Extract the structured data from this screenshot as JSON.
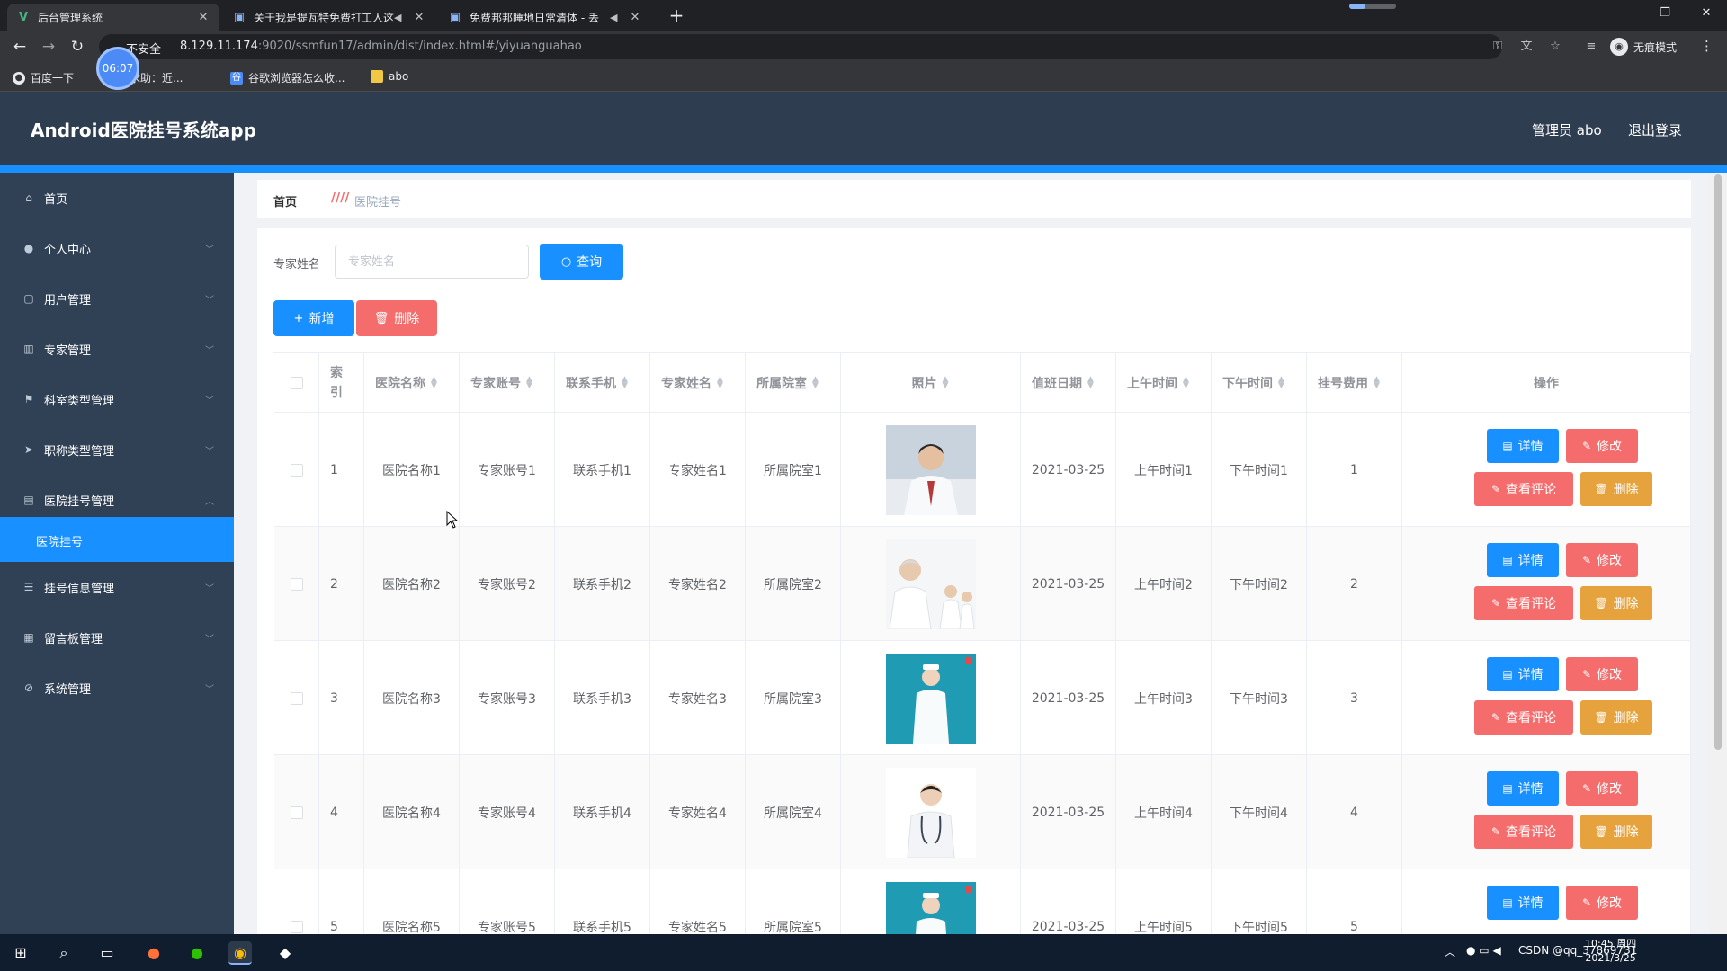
{
  "browser": {
    "tabs": [
      {
        "title": "后台管理系统",
        "active": true
      },
      {
        "title": "关于我是提瓦特免费打工人这",
        "active": false
      },
      {
        "title": "免费邦邦睡地日常清体 - 丢",
        "active": false
      }
    ],
    "timer": "06:07",
    "insecure_label": "不安全",
    "url_host": "8.129.11.174",
    "url_rest": ":9020/ssmfun17/admin/dist/index.html#/yiyuanguahao",
    "incognito_label": "无痕模式",
    "bookmarks": [
      "百度一下",
      "求助：近...",
      "谷歌浏览器怎么收...",
      "abo"
    ]
  },
  "header": {
    "title": "Android医院挂号系统app",
    "admin": "管理员 abo",
    "logout": "退出登录"
  },
  "sidebar": {
    "items": [
      {
        "label": "首页",
        "icon": "home-icon"
      },
      {
        "label": "个人中心",
        "icon": "user-icon"
      },
      {
        "label": "用户管理",
        "icon": "document-icon"
      },
      {
        "label": "专家管理",
        "icon": "chart-icon"
      },
      {
        "label": "科室类型管理",
        "icon": "flag-icon"
      },
      {
        "label": "职称类型管理",
        "icon": "send-icon"
      },
      {
        "label": "医院挂号管理",
        "icon": "bank-icon"
      },
      {
        "label": "挂号信息管理",
        "icon": "list-icon"
      },
      {
        "label": "留言板管理",
        "icon": "notebook-icon"
      },
      {
        "label": "系统管理",
        "icon": "compass-icon"
      }
    ],
    "active_sub": "医院挂号"
  },
  "breadcrumb": {
    "home": "首页",
    "current": "医院挂号"
  },
  "search": {
    "label": "专家姓名",
    "placeholder": "专家姓名",
    "button": "查询"
  },
  "actions": {
    "add": "新增",
    "delete": "删除"
  },
  "table": {
    "headers": [
      "索引",
      "医院名称",
      "专家账号",
      "联系手机",
      "专家姓名",
      "所属院室",
      "照片",
      "值班日期",
      "上午时间",
      "下午时间",
      "挂号费用",
      "操作"
    ],
    "rows": [
      [
        "1",
        "医院名称1",
        "专家账号1",
        "联系手机1",
        "专家姓名1",
        "所属院室1",
        "2021-03-25",
        "上午时间1",
        "下午时间1",
        "1"
      ],
      [
        "2",
        "医院名称2",
        "专家账号2",
        "联系手机2",
        "专家姓名2",
        "所属院室2",
        "2021-03-25",
        "上午时间2",
        "下午时间2",
        "2"
      ],
      [
        "3",
        "医院名称3",
        "专家账号3",
        "联系手机3",
        "专家姓名3",
        "所属院室3",
        "2021-03-25",
        "上午时间3",
        "下午时间3",
        "3"
      ],
      [
        "4",
        "医院名称4",
        "专家账号4",
        "联系手机4",
        "专家姓名4",
        "所属院室4",
        "2021-03-25",
        "上午时间4",
        "下午时间4",
        "4"
      ],
      [
        "5",
        "医院名称5",
        "专家账号5",
        "联系手机5",
        "专家姓名5",
        "所属院室5",
        "2021-03-25",
        "上午时间5",
        "下午时间5",
        "5"
      ]
    ],
    "row_actions": {
      "detail": "详情",
      "edit": "修改",
      "comments": "查看评论",
      "delete": "删除"
    }
  },
  "taskbar": {
    "clock_time": "10:45 周四",
    "clock_date": "2021/3/25",
    "tray_text": "CSDN @qq_37869731"
  },
  "colors": {
    "primary": "#1890ff",
    "danger": "#f56c6c",
    "warning": "#e6a23c",
    "sidebar": "#304156",
    "header": "#2f3d50"
  }
}
